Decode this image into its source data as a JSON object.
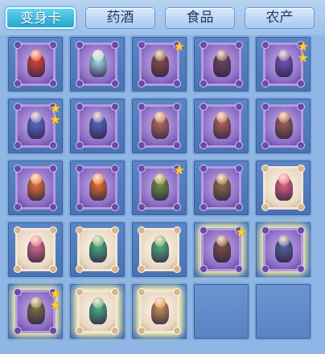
{
  "tabs": [
    {
      "label": "变身卡",
      "active": true
    },
    {
      "label": "药酒",
      "active": false
    },
    {
      "label": "食品",
      "active": false
    },
    {
      "label": "农产",
      "active": false
    }
  ],
  "items": [
    {
      "card": "purple",
      "creature": "red-fire-beast-icon",
      "color": "#d8402a",
      "stars": 0,
      "glow": false
    },
    {
      "card": "purple",
      "creature": "fairy-spirit-icon",
      "color": "#9fe0e8",
      "stars": 0,
      "glow": false
    },
    {
      "card": "purple",
      "creature": "bull-rider-icon",
      "color": "#7a4a3a",
      "stars": 1,
      "glow": false
    },
    {
      "card": "purple",
      "creature": "bull-rider-icon",
      "color": "#6a3f55",
      "stars": 0,
      "glow": false
    },
    {
      "card": "purple",
      "creature": "masked-imp-icon",
      "color": "#6e4db8",
      "stars": 2,
      "glow": false
    },
    {
      "card": "purple",
      "creature": "blue-demon-icon",
      "color": "#5566c8",
      "stars": 2,
      "glow": false
    },
    {
      "card": "purple",
      "creature": "blue-demon-icon",
      "color": "#4e5fbf",
      "stars": 0,
      "glow": false
    },
    {
      "card": "purple",
      "creature": "bat-warrior-icon",
      "color": "#b06a52",
      "stars": 0,
      "glow": false
    },
    {
      "card": "purple",
      "creature": "bat-warrior-icon",
      "color": "#a85f4c",
      "stars": 0,
      "glow": false
    },
    {
      "card": "purple",
      "creature": "bat-warrior-icon",
      "color": "#9a5a48",
      "stars": 0,
      "glow": false
    },
    {
      "card": "purple",
      "creature": "phoenix-icon",
      "color": "#e2702c",
      "stars": 0,
      "glow": false
    },
    {
      "card": "purple",
      "creature": "phoenix-icon",
      "color": "#e86a28",
      "stars": 0,
      "glow": false
    },
    {
      "card": "purple",
      "creature": "armored-knight-icon",
      "color": "#6d8a3c",
      "stars": 1,
      "glow": false
    },
    {
      "card": "purple",
      "creature": "armored-knight-icon",
      "color": "#8a6a3c",
      "stars": 0,
      "glow": false
    },
    {
      "card": "white",
      "creature": "pink-hair-girl-icon",
      "color": "#e0587e",
      "stars": 0,
      "glow": false
    },
    {
      "card": "white",
      "creature": "pink-hair-girl-icon",
      "color": "#d8608a",
      "stars": 0,
      "glow": false
    },
    {
      "card": "white",
      "creature": "green-hair-girl-icon",
      "color": "#3faa7a",
      "stars": 0,
      "glow": false
    },
    {
      "card": "white",
      "creature": "green-hair-girl-icon",
      "color": "#46a878",
      "stars": 0,
      "glow": false
    },
    {
      "card": "purple",
      "creature": "bull-rider-icon",
      "color": "#7a4a3a",
      "stars": 1,
      "glow": true
    },
    {
      "card": "purple",
      "creature": "ogre-warrior-icon",
      "color": "#4a5e9a",
      "stars": 0,
      "glow": true
    },
    {
      "card": "purple",
      "creature": "armored-knight-icon",
      "color": "#7a6a3c",
      "stars": 2,
      "glow": true
    },
    {
      "card": "white",
      "creature": "green-hair-girl-icon",
      "color": "#3faa7a",
      "stars": 0,
      "glow": true
    },
    {
      "card": "white",
      "creature": "monk-warrior-icon",
      "color": "#c48a4a",
      "stars": 0,
      "glow": true
    },
    {
      "empty": true
    },
    {
      "empty": true
    }
  ]
}
